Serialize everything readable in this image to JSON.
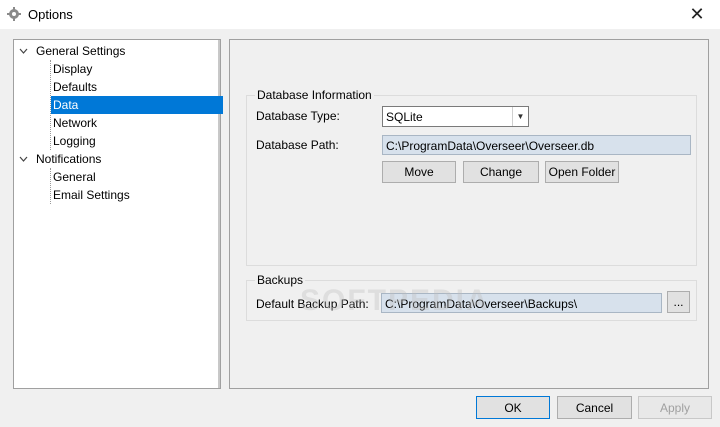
{
  "window": {
    "title": "Options",
    "close_glyph": "✕"
  },
  "tree": {
    "nodes": [
      {
        "label": "General Settings",
        "level": 0,
        "expanded": true
      },
      {
        "label": "Display",
        "level": 1
      },
      {
        "label": "Defaults",
        "level": 1
      },
      {
        "label": "Data",
        "level": 1,
        "selected": true
      },
      {
        "label": "Network",
        "level": 1
      },
      {
        "label": "Logging",
        "level": 1
      },
      {
        "label": "Notifications",
        "level": 0,
        "expanded": true
      },
      {
        "label": "General",
        "level": 1
      },
      {
        "label": "Email Settings",
        "level": 1
      }
    ]
  },
  "database": {
    "legend": "Database Information",
    "type_label": "Database Type:",
    "type_value": "SQLite",
    "path_label": "Database Path:",
    "path_value": "C:\\ProgramData\\Overseer\\Overseer.db",
    "buttons": {
      "move": "Move",
      "change": "Change",
      "open_folder": "Open Folder"
    }
  },
  "backups": {
    "legend": "Backups",
    "path_label": "Default Backup Path:",
    "path_value": "C:\\ProgramData\\Overseer\\Backups\\",
    "browse": "..."
  },
  "footer": {
    "ok": "OK",
    "cancel": "Cancel",
    "apply": "Apply"
  },
  "watermark": "SOFTPEDIA",
  "colors": {
    "selection": "#0078d7",
    "readonly_field": "#d7e1ec"
  }
}
